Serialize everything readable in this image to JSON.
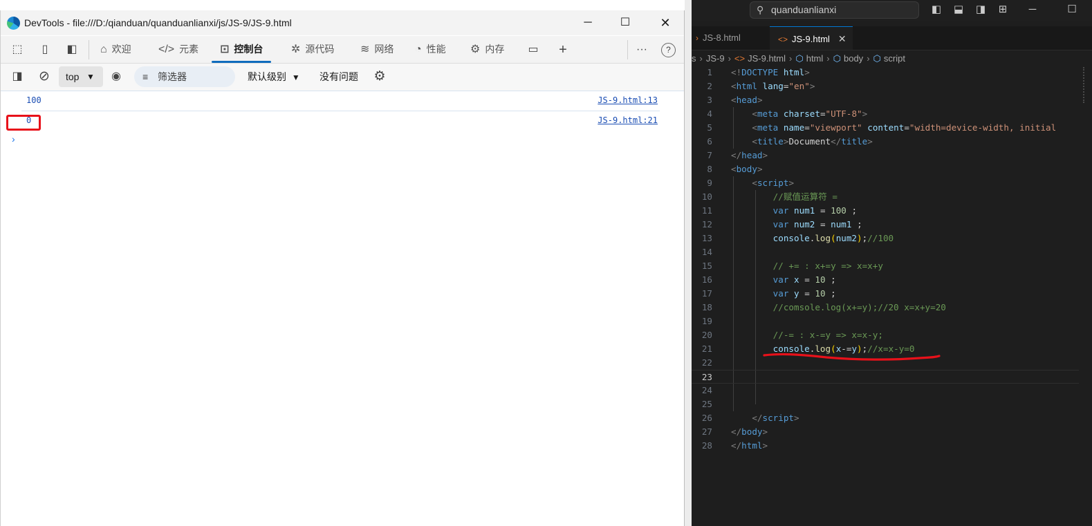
{
  "devtools": {
    "window_title": "DevTools - file:///D:/qianduan/quanduanlianxi/js/JS-9/JS-9.html",
    "tabs": [
      {
        "label": "欢迎",
        "icon": "home-icon"
      },
      {
        "label": "元素",
        "icon": "code-brackets-icon"
      },
      {
        "label": "控制台",
        "icon": "console-icon",
        "active": true
      },
      {
        "label": "源代码",
        "icon": "bug-icon"
      },
      {
        "label": "网络",
        "icon": "wifi-icon"
      },
      {
        "label": "性能",
        "icon": "gauge-icon"
      },
      {
        "label": "内存",
        "icon": "chip-icon"
      }
    ],
    "toolbar": {
      "context": "top",
      "filter_label": "筛选器",
      "level_label": "默认级别",
      "issues_label": "没有问题"
    },
    "console": [
      {
        "value": "100",
        "source": "JS-9.html:13"
      },
      {
        "value": "0",
        "source": "JS-9.html:21"
      }
    ]
  },
  "vscode": {
    "search_text": "quanduanlianxi",
    "tabs": [
      {
        "label": "JS-8.html"
      },
      {
        "label": "JS-9.html",
        "active": true
      }
    ],
    "breadcrumb": [
      "s",
      "JS-9",
      "JS-9.html",
      "html",
      "body",
      "script"
    ],
    "line_numbers": [
      "1",
      "2",
      "3",
      "4",
      "5",
      "6",
      "7",
      "8",
      "9",
      "10",
      "11",
      "12",
      "13",
      "14",
      "15",
      "16",
      "17",
      "18",
      "19",
      "20",
      "21",
      "22",
      "23",
      "24",
      "25",
      "26",
      "27",
      "28"
    ],
    "current_line": "23"
  },
  "colors": {
    "highlight_box": "#e8111a",
    "annotation_underline": "#e8111a",
    "devtools_accent": "#0f6cbd",
    "vscode_bg": "#1e1e1e"
  }
}
